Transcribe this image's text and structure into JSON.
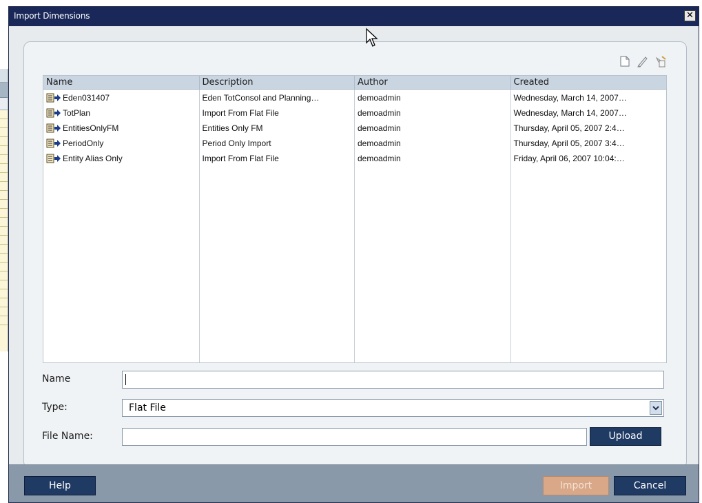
{
  "window": {
    "title": "Import Dimensions",
    "close_glyph": "✕"
  },
  "toolbar": {
    "icons": [
      "new-document-icon",
      "edit-pencil-icon",
      "delete-icon"
    ]
  },
  "table": {
    "columns": [
      "Name",
      "Description",
      "Author",
      "Created"
    ],
    "rows": [
      {
        "name": "Eden031407",
        "description": "Eden TotConsol and Planning…",
        "author": "demoadmin",
        "created": "Wednesday, March 14, 2007…"
      },
      {
        "name": "TotPlan",
        "description": "Import From Flat File",
        "author": "demoadmin",
        "created": "Wednesday, March 14, 2007…"
      },
      {
        "name": "EntitiesOnlyFM",
        "description": "Entities Only FM",
        "author": "demoadmin",
        "created": "Thursday, April 05, 2007 2:4…"
      },
      {
        "name": "PeriodOnly",
        "description": "Period Only Import",
        "author": "demoadmin",
        "created": "Thursday, April 05, 2007 3:4…"
      },
      {
        "name": "Entity Alias Only",
        "description": "Import From Flat File",
        "author": "demoadmin",
        "created": "Friday, April 06, 2007 10:04:…"
      }
    ]
  },
  "form": {
    "name_label": "Name",
    "name_value": "",
    "type_label": "Type:",
    "type_value": "Flat File",
    "file_label": "File Name:",
    "file_value": "",
    "upload_label": "Upload"
  },
  "footer": {
    "help_label": "Help",
    "import_label": "Import",
    "cancel_label": "Cancel"
  },
  "colors": {
    "titlebar": "#1a2859",
    "button": "#1f3a63",
    "button_disabled": "#d9a888",
    "footer": "#8a99aa",
    "grid_header": "#c9d5e1"
  }
}
